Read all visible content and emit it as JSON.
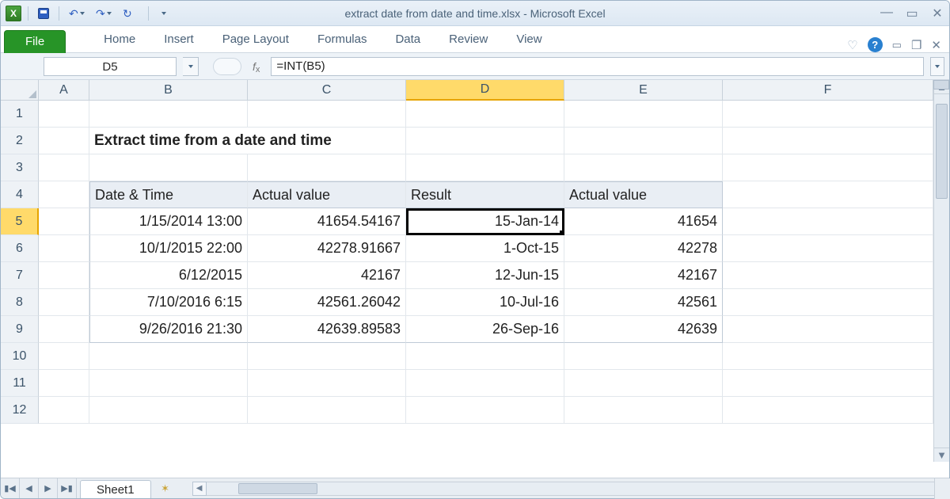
{
  "title": "extract date from date and time.xlsx - Microsoft Excel",
  "qat": {
    "logo_letter": "X"
  },
  "ribbon": {
    "file": "File",
    "tabs": [
      "Home",
      "Insert",
      "Page Layout",
      "Formulas",
      "Data",
      "Review",
      "View"
    ]
  },
  "namebox": "D5",
  "formula": "=INT(B5)",
  "columns": [
    "A",
    "B",
    "C",
    "D",
    "E",
    "F"
  ],
  "active_column_index": 3,
  "rows": [
    1,
    2,
    3,
    4,
    5,
    6,
    7,
    8,
    9,
    10,
    11,
    12
  ],
  "active_row_index": 4,
  "sheet": {
    "title_cell": "Extract time from a date and time",
    "headers": [
      "Date & Time",
      "Actual value",
      "Result",
      "Actual value"
    ],
    "body": [
      {
        "b": "1/15/2014 13:00",
        "c": "41654.54167",
        "d": "15-Jan-14",
        "e": "41654"
      },
      {
        "b": "10/1/2015 22:00",
        "c": "42278.91667",
        "d": "1-Oct-15",
        "e": "42278"
      },
      {
        "b": "6/12/2015",
        "c": "42167",
        "d": "12-Jun-15",
        "e": "42167"
      },
      {
        "b": "7/10/2016 6:15",
        "c": "42561.26042",
        "d": "10-Jul-16",
        "e": "42561"
      },
      {
        "b": "9/26/2016 21:30",
        "c": "42639.89583",
        "d": "26-Sep-16",
        "e": "42639"
      }
    ]
  },
  "sheettab": "Sheet1"
}
